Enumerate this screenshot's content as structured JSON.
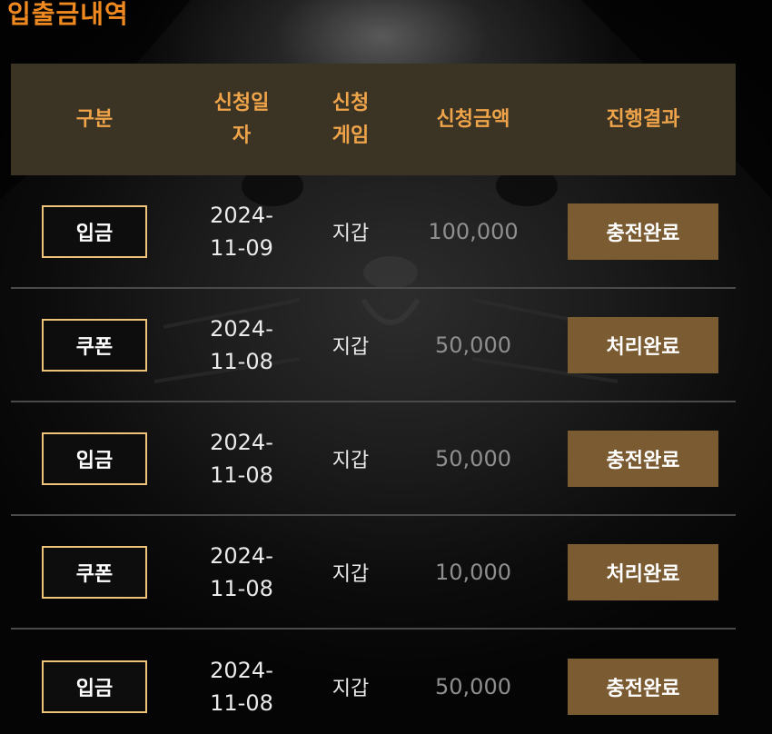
{
  "page": {
    "title": "입출금내역"
  },
  "table": {
    "headers": {
      "type": "구분",
      "date_line1": "신청일",
      "date_line2": "자",
      "game_line1": "신청",
      "game_line2": "게임",
      "amount": "신청금액",
      "result": "진행결과"
    },
    "rows": [
      {
        "type": "입금",
        "date_line1": "2024-",
        "date_line2": "11-09",
        "game": "지갑",
        "amount": "100,000",
        "status": "충전완료"
      },
      {
        "type": "쿠폰",
        "date_line1": "2024-",
        "date_line2": "11-08",
        "game": "지갑",
        "amount": "50,000",
        "status": "처리완료"
      },
      {
        "type": "입금",
        "date_line1": "2024-",
        "date_line2": "11-08",
        "game": "지갑",
        "amount": "50,000",
        "status": "충전완료"
      },
      {
        "type": "쿠폰",
        "date_line1": "2024-",
        "date_line2": "11-08",
        "game": "지갑",
        "amount": "10,000",
        "status": "처리완료"
      },
      {
        "type": "입금",
        "date_line1": "2024-",
        "date_line2": "11-08",
        "game": "지갑",
        "amount": "50,000",
        "status": "충전완료"
      }
    ]
  },
  "colors": {
    "title": "#f08a20",
    "header_bg": "#3b3425",
    "header_text": "#f0a44a",
    "badge_border": "#f0c27a",
    "status_bg": "#7b5b32",
    "amount_text": "#8f8f8f"
  }
}
